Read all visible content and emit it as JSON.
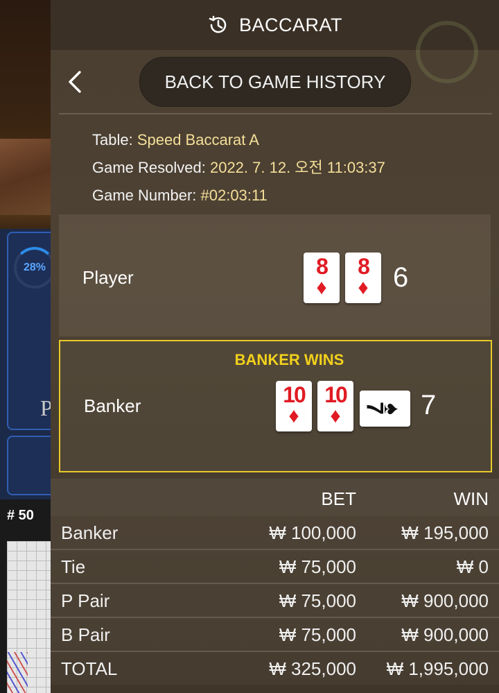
{
  "header": {
    "title": "BACCARAT",
    "icon": "history-icon"
  },
  "background": {
    "percent": "28%",
    "round": "# 50"
  },
  "nav": {
    "back_label": "BACK TO GAME HISTORY"
  },
  "info": {
    "table_label": "Table: ",
    "table_value": "Speed Baccarat A",
    "resolved_label": "Game Resolved: ",
    "resolved_value": "2022. 7. 12. 오전 11:03:37",
    "number_label": "Game Number: ",
    "number_value": "#02:03:11"
  },
  "result": {
    "player": {
      "label": "Player",
      "score": "6",
      "cards": [
        {
          "rank": "8",
          "suit": "♦"
        },
        {
          "rank": "8",
          "suit": "♦"
        }
      ]
    },
    "banker": {
      "label": "Banker",
      "score": "7",
      "wins_label": "BANKER WINS",
      "cards": [
        {
          "rank": "10",
          "suit": "♦"
        },
        {
          "rank": "10",
          "suit": "♦"
        }
      ],
      "third_card": {
        "rank": "7",
        "suit": "♠"
      }
    }
  },
  "bets": {
    "headers": {
      "bet": "BET",
      "win": "WIN"
    },
    "rows": [
      {
        "name": "Banker",
        "bet": "₩ 100,000",
        "win": "₩ 195,000"
      },
      {
        "name": "Tie",
        "bet": "₩ 75,000",
        "win": "₩ 0"
      },
      {
        "name": "P Pair",
        "bet": "₩ 75,000",
        "win": "₩ 900,000"
      },
      {
        "name": "B Pair",
        "bet": "₩ 75,000",
        "win": "₩ 900,000"
      }
    ],
    "total": {
      "name": "TOTAL",
      "bet": "₩ 325,000",
      "win": "₩ 1,995,000"
    }
  },
  "colors": {
    "accent": "#e8cb2a",
    "value_text": "#f5df9a",
    "card_red": "#e01b24"
  }
}
